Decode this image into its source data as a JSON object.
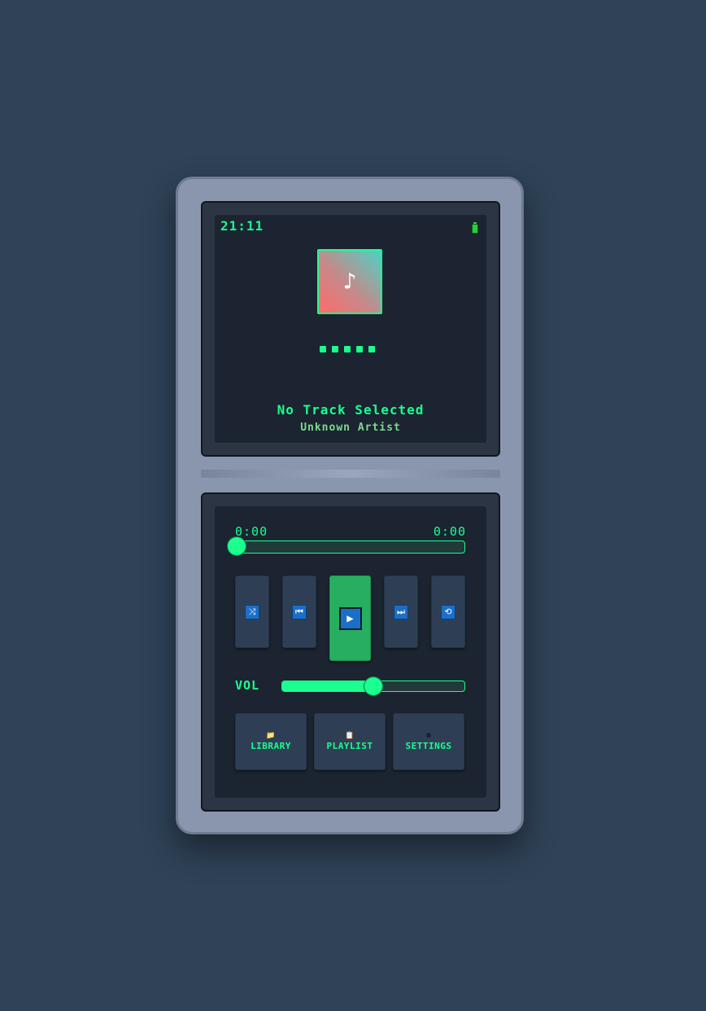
{
  "status": {
    "time": "21:11"
  },
  "now_playing": {
    "album_art_icon": "music-note-icon",
    "album_art_glyph": "♪",
    "title": "No Track Selected",
    "artist": "Unknown Artist",
    "visualizer_bars": 5
  },
  "progress": {
    "current": "0:00",
    "total": "0:00",
    "position_fraction": 0
  },
  "controls": {
    "shuffle": {
      "icon": "shuffle-icon",
      "glyph": "⤨"
    },
    "previous": {
      "icon": "previous-track-icon",
      "glyph": "⏮"
    },
    "play": {
      "icon": "play-icon",
      "glyph": "▶"
    },
    "next": {
      "icon": "next-track-icon",
      "glyph": "⏭"
    },
    "repeat": {
      "icon": "repeat-icon",
      "glyph": "⟲"
    }
  },
  "volume": {
    "label": "VOL",
    "level_fraction": 0.5
  },
  "nav": {
    "library": {
      "label": "LIBRARY",
      "icon": "folder-icon",
      "glyph": "📁"
    },
    "playlist": {
      "label": "PLAYLIST",
      "icon": "list-icon",
      "glyph": "📋"
    },
    "settings": {
      "label": "SETTINGS",
      "icon": "gear-icon",
      "glyph": "⚙"
    }
  },
  "colors": {
    "accent": "#1aff8f",
    "play_button": "#27ae60",
    "icon_blue": "#1a6fc7",
    "screen": "#1b2430",
    "device_body": "#8a96ad",
    "background": "#2f4257"
  }
}
